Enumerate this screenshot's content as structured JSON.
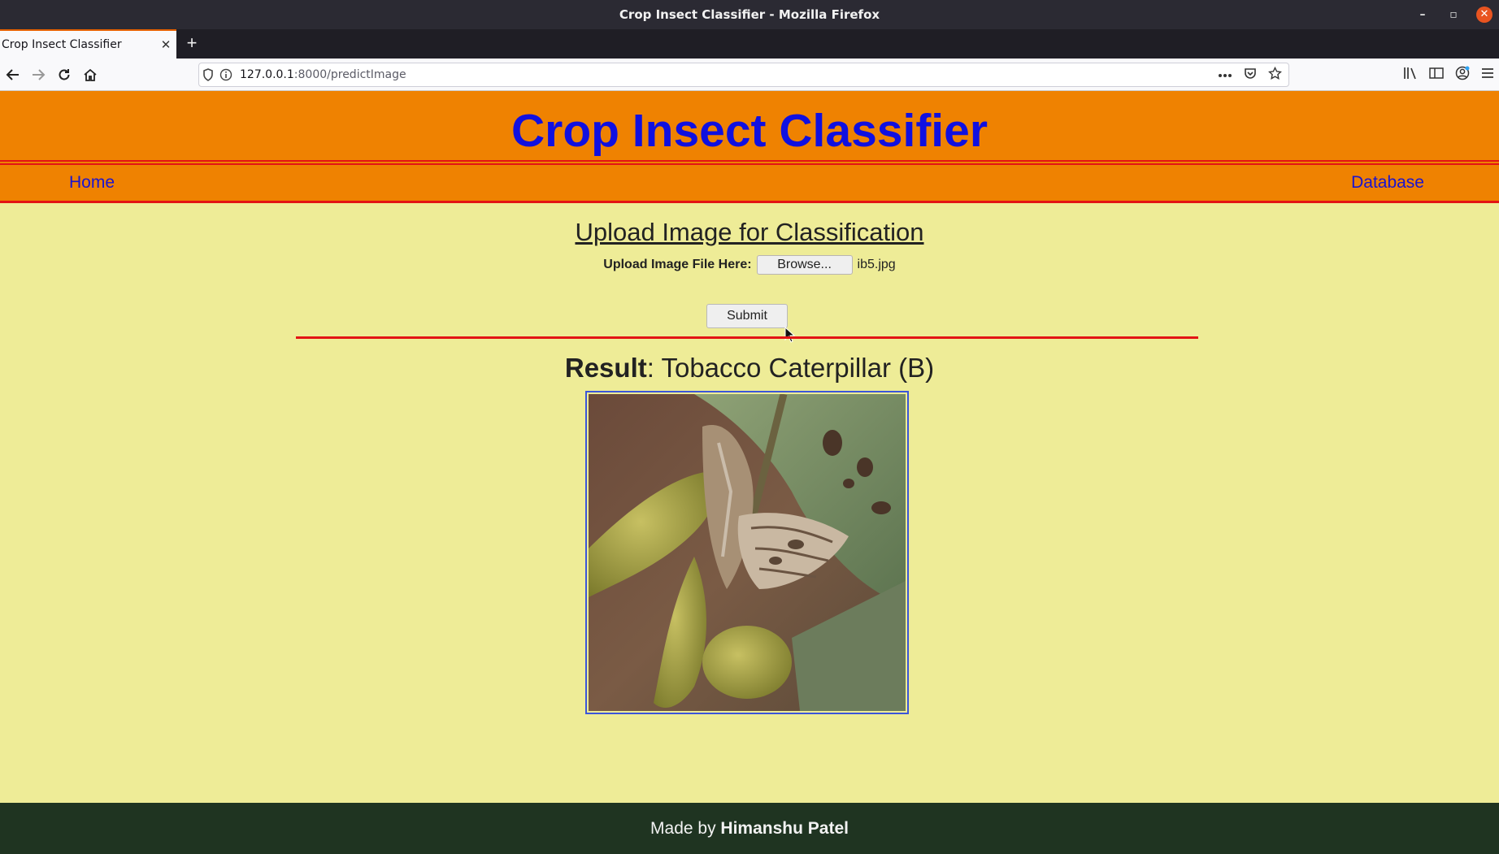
{
  "window": {
    "title": "Crop Insect Classifier - Mozilla Firefox"
  },
  "browser": {
    "tab_title": "Crop Insect Classifier",
    "url_host": "127.0.0.1",
    "url_path": ":8000/predictImage"
  },
  "site": {
    "title": "Crop Insect Classifier",
    "nav": {
      "home": "Home",
      "database": "Database"
    }
  },
  "upload": {
    "heading": "Upload Image for Classification",
    "label": "Upload Image File Here:",
    "browse_label": "Browse...",
    "file_name": "ib5.jpg",
    "submit_label": "Submit"
  },
  "result": {
    "label": "Result",
    "value": ": Tobacco Caterpillar (B)"
  },
  "footer": {
    "prefix": "Made by ",
    "author": "Himanshu Patel"
  },
  "colors": {
    "header_bg": "#ef8201",
    "title": "#1010e0",
    "accent_line": "#e31414",
    "page_bg": "#eeec97",
    "footer_bg": "#1f3421"
  }
}
